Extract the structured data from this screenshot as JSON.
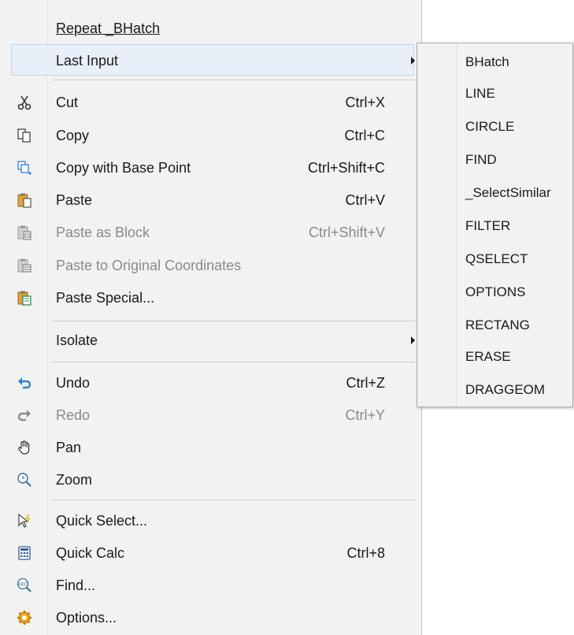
{
  "menu": {
    "repeat": {
      "label": "Repeat _BHatch"
    },
    "last_input": {
      "label": "Last Input"
    },
    "cut": {
      "label": "Cut",
      "shortcut": "Ctrl+X",
      "icon": "scissors-icon"
    },
    "copy": {
      "label": "Copy",
      "shortcut": "Ctrl+C",
      "icon": "copy-icon"
    },
    "copy_base": {
      "label": "Copy with Base Point",
      "shortcut": "Ctrl+Shift+C",
      "icon": "copy-base-point-icon"
    },
    "paste": {
      "label": "Paste",
      "shortcut": "Ctrl+V",
      "icon": "paste-icon"
    },
    "paste_block": {
      "label": "Paste as Block",
      "shortcut": "Ctrl+Shift+V",
      "icon": "paste-block-icon",
      "disabled": true
    },
    "paste_orig": {
      "label": "Paste to Original Coordinates",
      "icon": "paste-coordinates-icon",
      "disabled": true
    },
    "paste_special": {
      "label": "Paste Special...",
      "icon": "paste-special-icon"
    },
    "isolate": {
      "label": "Isolate"
    },
    "undo": {
      "label": "Undo",
      "shortcut": "Ctrl+Z",
      "icon": "undo-icon"
    },
    "redo": {
      "label": "Redo",
      "shortcut": "Ctrl+Y",
      "icon": "redo-icon",
      "disabled": true
    },
    "pan": {
      "label": "Pan",
      "icon": "hand-icon"
    },
    "zoom": {
      "label": "Zoom",
      "icon": "zoom-icon"
    },
    "quick_select": {
      "label": "Quick Select...",
      "icon": "quick-select-icon"
    },
    "quick_calc": {
      "label": "Quick Calc",
      "shortcut": "Ctrl+8",
      "icon": "calculator-icon"
    },
    "find": {
      "label": "Find...",
      "icon": "find-text-icon"
    },
    "options": {
      "label": "Options...",
      "icon": "options-gear-icon"
    }
  },
  "submenu": {
    "items": [
      "BHatch",
      "LINE",
      "CIRCLE",
      "FIND",
      "_SelectSimilar",
      "FILTER",
      "QSELECT",
      "OPTIONS",
      "RECTANG",
      "ERASE",
      "DRAGGEOM"
    ]
  },
  "colors": {
    "menu_bg": "#f2f2f2",
    "highlight_bg": "#e9eff8",
    "disabled_text": "#8a8a8a",
    "accent_blue": "#2f7fd1"
  }
}
